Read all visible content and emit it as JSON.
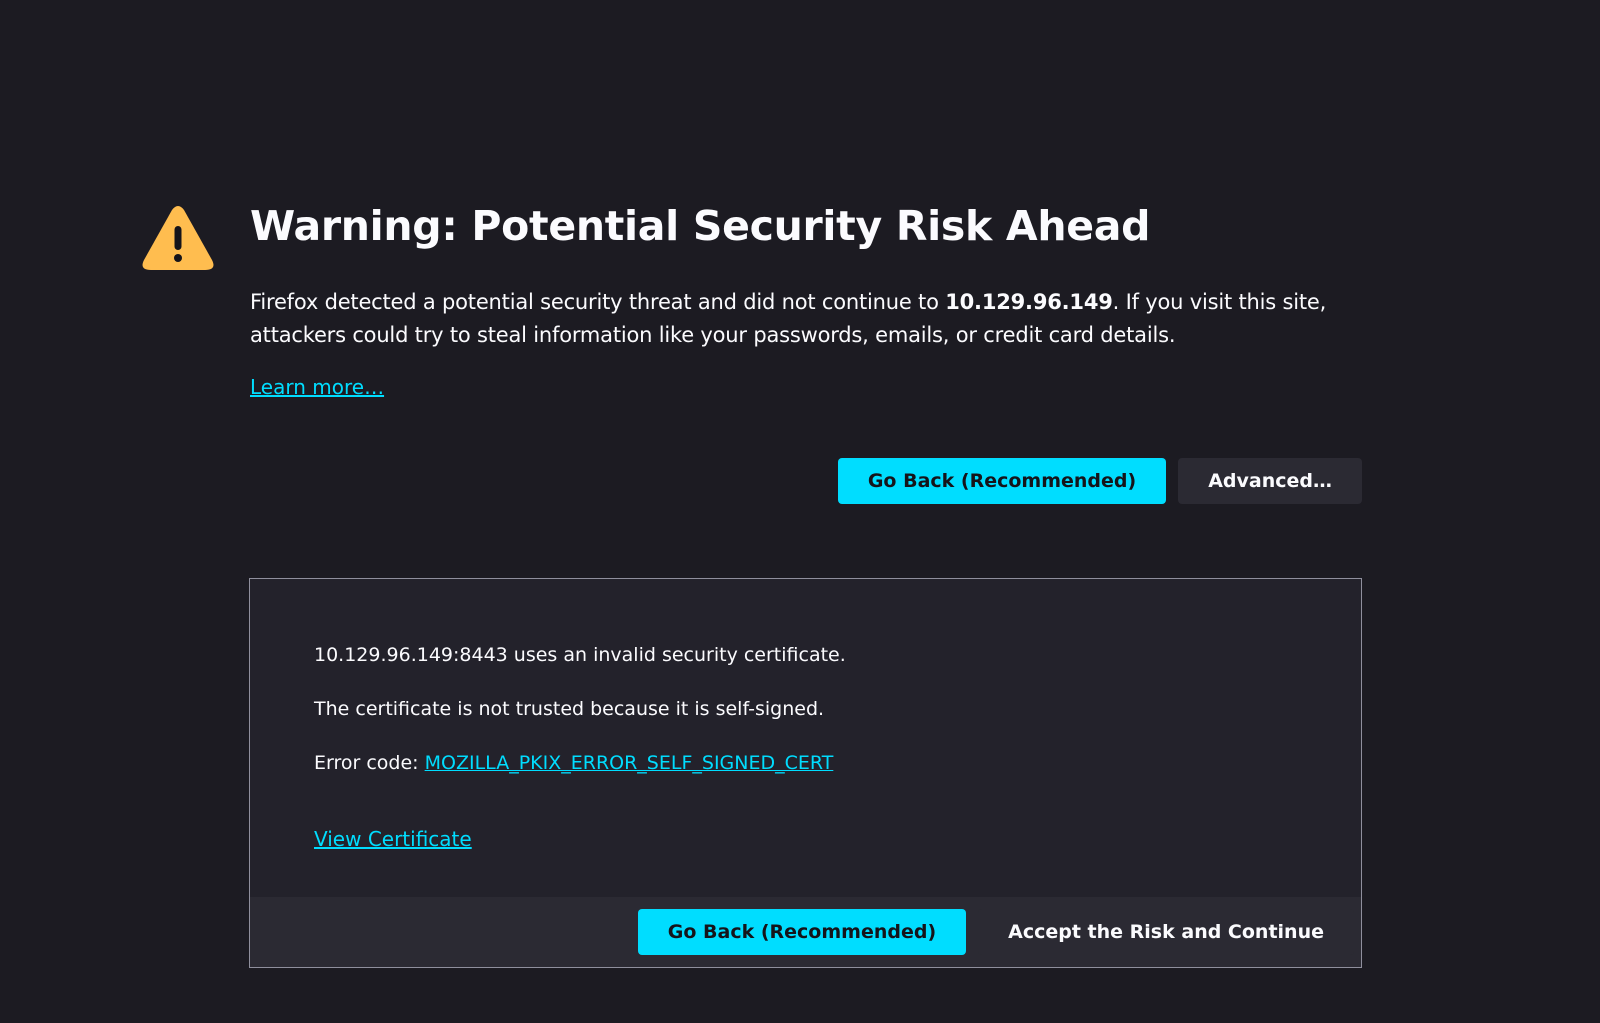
{
  "page": {
    "title": "Warning: Potential Security Risk Ahead",
    "intro_before": "Firefox detected a potential security threat and did not continue to ",
    "host": "10.129.96.149",
    "intro_after": ". If you visit this site, attackers could try to steal information like your passwords, emails, or credit card details.",
    "learn_more": "Learn more…",
    "go_back_label": "Go Back (Recommended)",
    "advanced_label": "Advanced…"
  },
  "advanced_panel": {
    "invalid_cert_text": "10.129.96.149:8443 uses an invalid security certificate.",
    "reason_text": "The certificate is not trusted because it is self-signed.",
    "error_code_prefix": "Error code: ",
    "error_code": "MOZILLA_PKIX_ERROR_SELF_SIGNED_CERT",
    "view_certificate": "View Certificate",
    "go_back_label": "Go Back (Recommended)",
    "accept_label": "Accept the Risk and Continue"
  },
  "colors": {
    "background": "#1c1b22",
    "accent": "#00ddff",
    "warning": "#ffbd4f"
  },
  "icons": {
    "warning": "warning-triangle-icon"
  }
}
